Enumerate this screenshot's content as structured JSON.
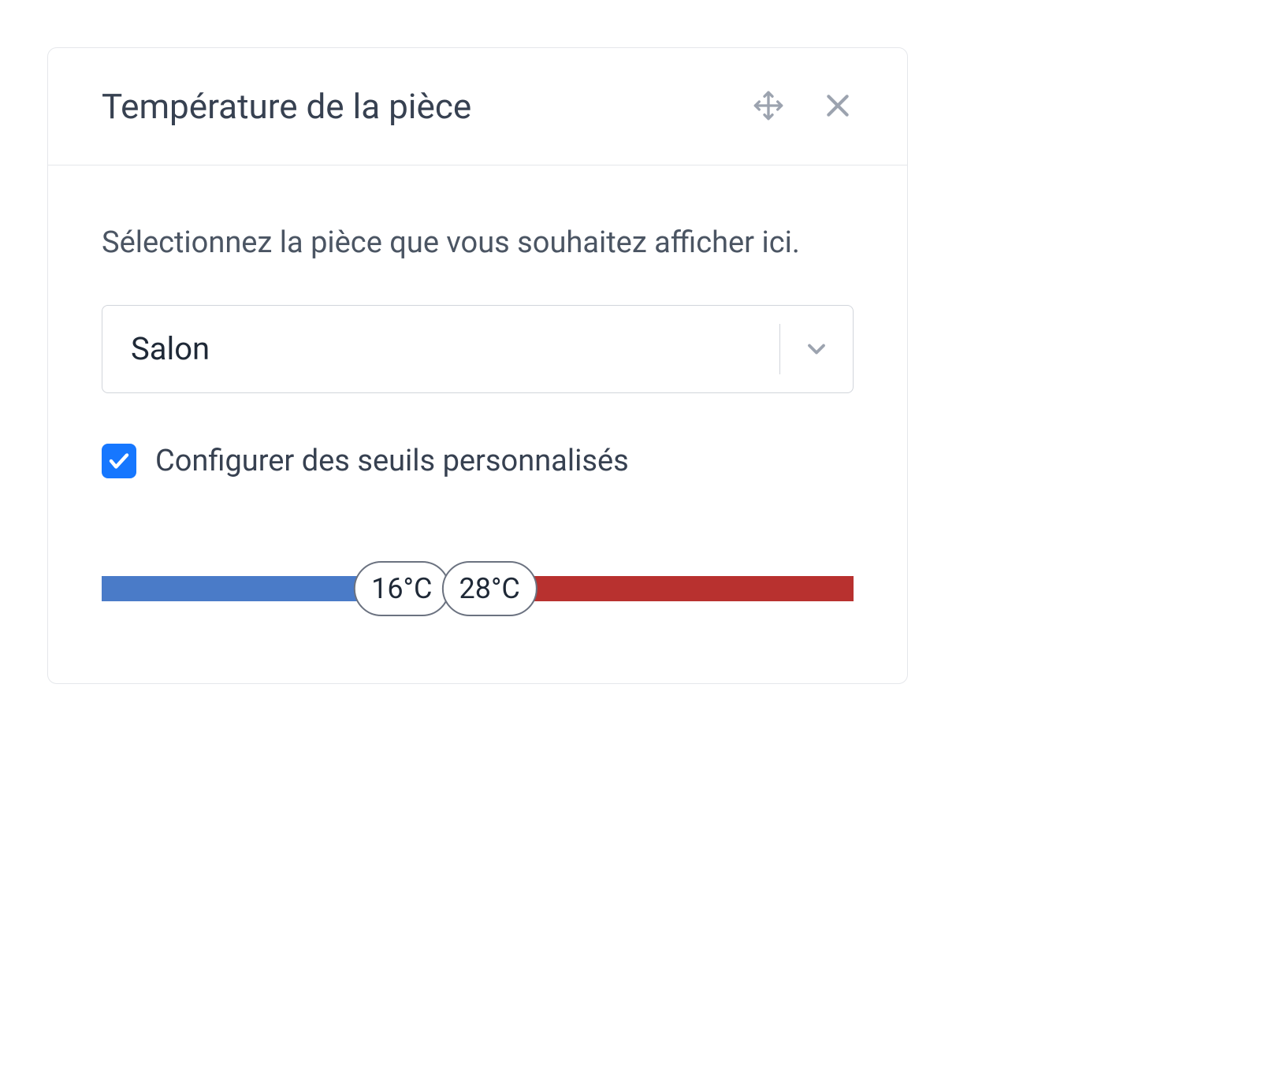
{
  "card": {
    "title": "Température de la pièce",
    "instruction": "Sélectionnez la pièce que vous souhaitez afficher ici."
  },
  "room_select": {
    "value": "Salon"
  },
  "thresholds": {
    "checkbox_label": "Configurer des seuils personnalisés",
    "checked": true,
    "low": "16°C",
    "high": "28°C"
  },
  "colors": {
    "cold": "#4a7bc8",
    "ok": "#7fb341",
    "hot": "#b8312f",
    "accent": "#1677ff"
  }
}
